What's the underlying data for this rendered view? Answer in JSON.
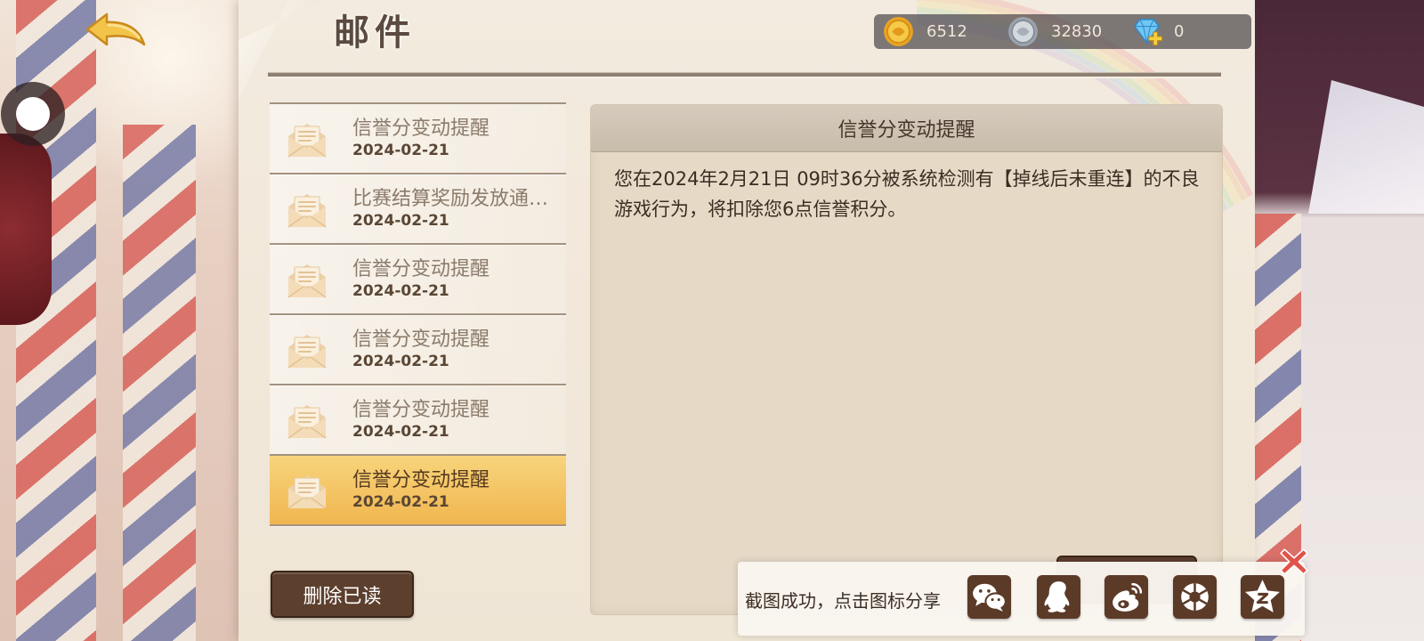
{
  "header": {
    "title": "邮件",
    "back_icon": "back-arrow-icon"
  },
  "currency": {
    "gold": {
      "icon": "gold-coin-icon",
      "value": "6512"
    },
    "silver": {
      "icon": "silver-coin-icon",
      "value": "32830"
    },
    "diamond": {
      "icon": "diamond-add-icon",
      "value": "0"
    }
  },
  "mail_icon": "envelope-icon",
  "mail_list": [
    {
      "title": "信誉分变动提醒",
      "date": "2024-02-21",
      "selected": false
    },
    {
      "title": "比赛结算奖励发放通…",
      "date": "2024-02-21",
      "selected": false
    },
    {
      "title": "信誉分变动提醒",
      "date": "2024-02-21",
      "selected": false
    },
    {
      "title": "信誉分变动提醒",
      "date": "2024-02-21",
      "selected": false
    },
    {
      "title": "信誉分变动提醒",
      "date": "2024-02-21",
      "selected": false
    },
    {
      "title": "信誉分变动提醒",
      "date": "2024-02-21",
      "selected": true
    }
  ],
  "actions": {
    "delete_read_label": "删除已读"
  },
  "detail": {
    "title": "信誉分变动提醒",
    "body": "您在2024年2月21日 09时36分被系统检测有【掉线后未重连】的不良游戏行为，将扣除您6点信誉积分。"
  },
  "share_bar": {
    "message": "截图成功，点击图标分享",
    "icons": [
      "wechat-icon",
      "qq-icon",
      "weibo-icon",
      "moments-icon",
      "qzone-icon"
    ],
    "close_icon": "close-x-icon"
  },
  "floating_button": {
    "icon": "assistive-touch-icon"
  },
  "colors": {
    "selected_item_top": "#f8d47c",
    "selected_item_bottom": "#f0b64f",
    "button_bg": "#5c3f2d",
    "share_icon_bg": "#5b3a28",
    "close_icon": "#e0524a",
    "stripe_red": "#d96a62",
    "stripe_blue": "#7f82aa"
  }
}
